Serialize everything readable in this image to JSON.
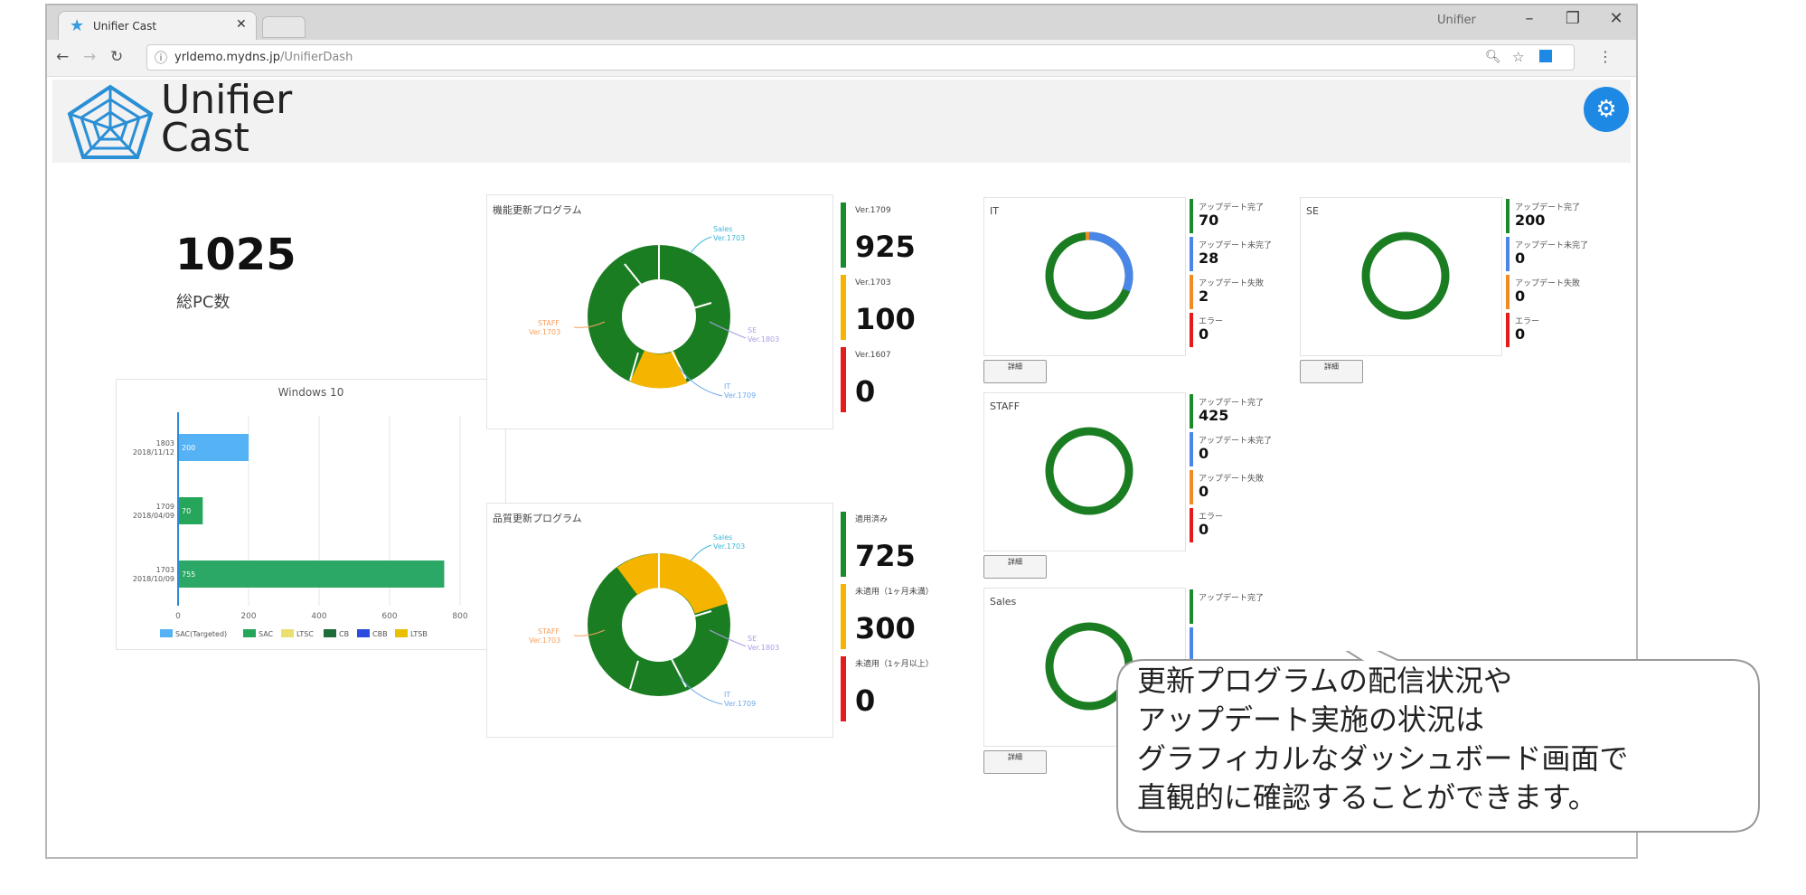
{
  "browser": {
    "tab_title": "Unifier Cast",
    "user_label": "Unifier",
    "url_host": "yrldemo.mydns.jp",
    "url_path": "/UnifierDash"
  },
  "header": {
    "logo_line1": "Unifier",
    "logo_line2": "Cast"
  },
  "summary": {
    "total_pc": "1025",
    "total_pc_label": "総PC数"
  },
  "feature_updates": {
    "title": "機能更新プログラム",
    "segments": [
      {
        "label": "Sales",
        "sub": "Ver.1703"
      },
      {
        "label": "SE",
        "sub": "Ver.1803"
      },
      {
        "label": "IT",
        "sub": "Ver.1709"
      },
      {
        "label": "STAFF",
        "sub": "Ver.1703"
      }
    ],
    "stats": [
      {
        "label": "Ver.1709",
        "value": "925",
        "color": "#1b8a2a"
      },
      {
        "label": "Ver.1703",
        "value": "100",
        "color": "#f5b400"
      },
      {
        "label": "Ver.1607",
        "value": "0",
        "color": "#e51b1b"
      }
    ]
  },
  "quality_updates": {
    "title": "品質更新プログラム",
    "segments": [
      {
        "label": "Sales",
        "sub": "Ver.1703"
      },
      {
        "label": "SE",
        "sub": "Ver.1803"
      },
      {
        "label": "IT",
        "sub": "Ver.1709"
      },
      {
        "label": "STAFF",
        "sub": "Ver.1703"
      }
    ],
    "stats": [
      {
        "label": "適用済み",
        "value": "725",
        "color": "#1b8a2a"
      },
      {
        "label": "未適用（1ヶ月未満）",
        "value": "300",
        "color": "#f5b400"
      },
      {
        "label": "未適用（1ヶ月以上）",
        "value": "0",
        "color": "#e51b1b"
      }
    ]
  },
  "groups": [
    {
      "name": "IT",
      "button": "詳細",
      "stats": [
        {
          "label": "アップデート完了",
          "value": "70",
          "color": "#1b8a2a"
        },
        {
          "label": "アップデート未完了",
          "value": "28",
          "color": "#4a86e8"
        },
        {
          "label": "アップデート失敗",
          "value": "2",
          "color": "#f08a24"
        },
        {
          "label": "エラー",
          "value": "0",
          "color": "#e51b1b"
        }
      ]
    },
    {
      "name": "SE",
      "button": "詳細",
      "stats": [
        {
          "label": "アップデート完了",
          "value": "200",
          "color": "#1b8a2a"
        },
        {
          "label": "アップデート未完了",
          "value": "0",
          "color": "#4a86e8"
        },
        {
          "label": "アップデート失敗",
          "value": "0",
          "color": "#f08a24"
        },
        {
          "label": "エラー",
          "value": "0",
          "color": "#e51b1b"
        }
      ]
    },
    {
      "name": "STAFF",
      "button": "詳細",
      "stats": [
        {
          "label": "アップデート完了",
          "value": "425",
          "color": "#1b8a2a"
        },
        {
          "label": "アップデート未完了",
          "value": "0",
          "color": "#4a86e8"
        },
        {
          "label": "アップデート失敗",
          "value": "0",
          "color": "#f08a24"
        },
        {
          "label": "エラー",
          "value": "0",
          "color": "#e51b1b"
        }
      ]
    },
    {
      "name": "Sales",
      "button": "詳細",
      "stats": [
        {
          "label": "アップデート完了",
          "value": "",
          "color": "#1b8a2a"
        },
        {
          "label": "",
          "value": "",
          "color": "#4a86e8"
        }
      ]
    }
  ],
  "callout": {
    "line1": "更新プログラムの配信状況や",
    "line2": "アップデート実施の状況は",
    "line3": "グラフィカルなダッシュボード画面で",
    "line4": "直観的に確認することができます。"
  },
  "chart_data": {
    "type": "bar",
    "title": "Windows 10",
    "orientation": "horizontal",
    "categories": [
      "1803\n2018/11/12",
      "1709\n2018/04/09",
      "1703\n2018/10/09"
    ],
    "values": [
      200,
      70,
      755
    ],
    "bar_labels": [
      "200",
      "70",
      "755"
    ],
    "bar_colors": [
      "#54b2f5",
      "#26a65b",
      "#2ca866"
    ],
    "xticks": [
      0,
      200,
      400,
      600,
      800
    ],
    "xlim": [
      0,
      800
    ],
    "legend": [
      {
        "name": "SAC(Targeted)",
        "color": "#54b2f5"
      },
      {
        "name": "SAC",
        "color": "#26a65b"
      },
      {
        "name": "LTSC",
        "color": "#e8e070"
      },
      {
        "name": "CB",
        "color": "#1e6e3a"
      },
      {
        "name": "CBB",
        "color": "#2a4de0"
      },
      {
        "name": "LTSB",
        "color": "#e8c000"
      }
    ]
  }
}
